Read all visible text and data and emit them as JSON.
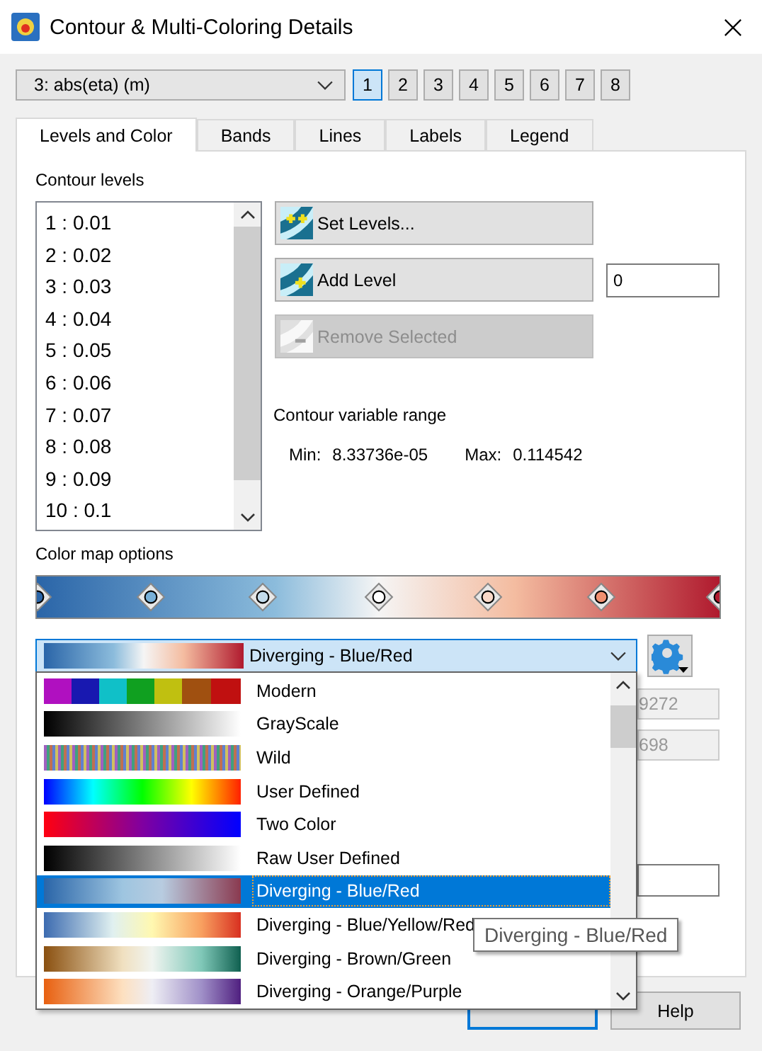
{
  "window": {
    "title": "Contour & Multi-Coloring Details"
  },
  "variable_select": {
    "value": "3: abs(eta) (m)"
  },
  "map_buttons": [
    {
      "label": "1",
      "selected": true
    },
    {
      "label": "2",
      "selected": false
    },
    {
      "label": "3",
      "selected": false
    },
    {
      "label": "4",
      "selected": false
    },
    {
      "label": "5",
      "selected": false
    },
    {
      "label": "6",
      "selected": false
    },
    {
      "label": "7",
      "selected": false
    },
    {
      "label": "8",
      "selected": false
    }
  ],
  "tabs": [
    {
      "label": "Levels and Color",
      "selected": true
    },
    {
      "label": "Bands",
      "selected": false
    },
    {
      "label": "Lines",
      "selected": false
    },
    {
      "label": "Labels",
      "selected": false
    },
    {
      "label": "Legend",
      "selected": false
    }
  ],
  "contour_levels": {
    "label": "Contour levels",
    "items": [
      "1 : 0.01",
      "2 : 0.02",
      "3 : 0.03",
      "4 : 0.04",
      "5 : 0.05",
      "6 : 0.06",
      "7 : 0.07",
      "8 : 0.08",
      "9 : 0.09",
      "10 : 0.1"
    ]
  },
  "level_buttons": [
    {
      "label": "Set Levels...",
      "kind": "set",
      "disabled": false
    },
    {
      "label": "Add Level",
      "kind": "add",
      "disabled": false
    },
    {
      "label": "Remove Selected",
      "kind": "remove",
      "disabled": true
    }
  ],
  "add_level_value": "0",
  "range": {
    "label": "Contour variable range",
    "min_label": "Min:",
    "min": "8.33736e-05",
    "max_label": "Max:",
    "max": "0.114542"
  },
  "color_map": {
    "label": "Color map options",
    "value": "Diverging - Blue/Red",
    "options": [
      {
        "label": "Modern",
        "selected": false
      },
      {
        "label": "GrayScale",
        "selected": false
      },
      {
        "label": "Wild",
        "selected": false
      },
      {
        "label": "User Defined",
        "selected": false
      },
      {
        "label": "Two Color",
        "selected": false
      },
      {
        "label": "Raw User Defined",
        "selected": false
      },
      {
        "label": "Diverging - Blue/Red",
        "selected": true
      },
      {
        "label": "Diverging - Blue/Yellow/Red",
        "selected": false
      },
      {
        "label": "Diverging - Brown/Green",
        "selected": false
      },
      {
        "label": "Diverging - Orange/Purple",
        "selected": false
      }
    ]
  },
  "covered_fields": [
    "9272",
    "698"
  ],
  "tooltip": "Diverging - Blue/Red",
  "footer_buttons": [
    "Help"
  ]
}
